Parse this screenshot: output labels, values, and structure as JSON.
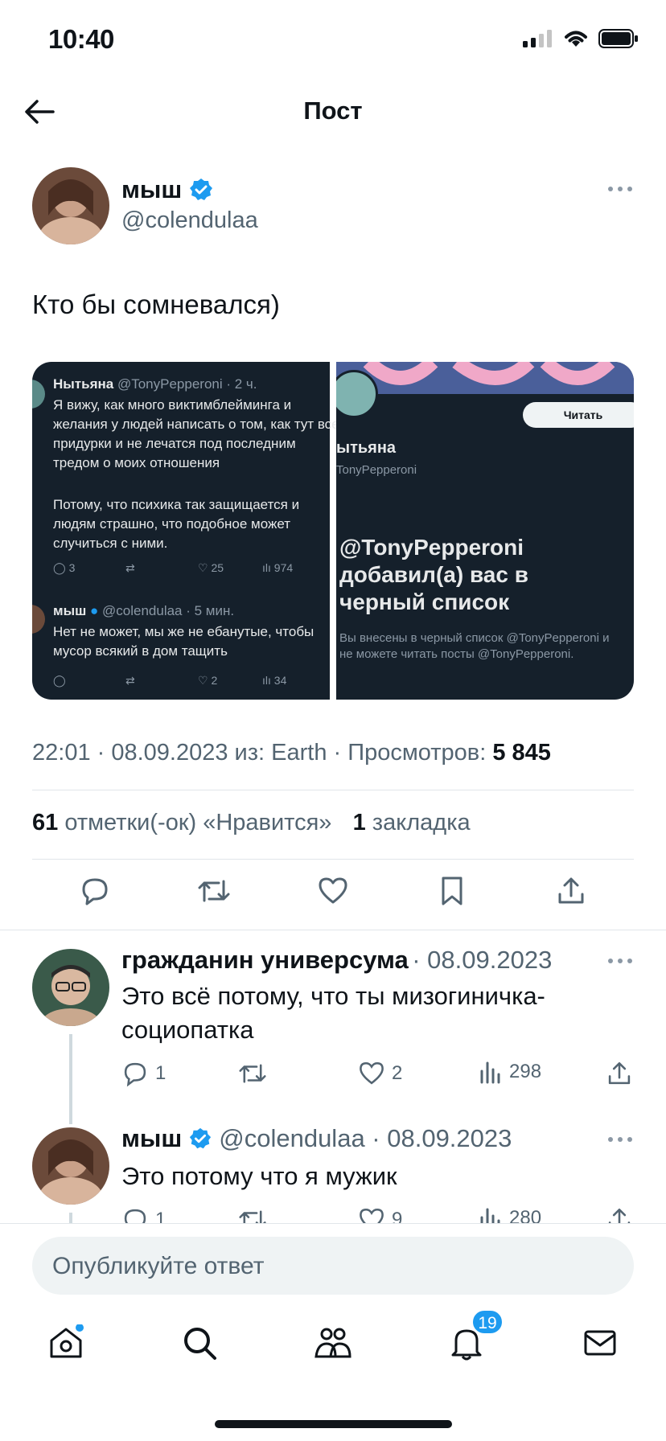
{
  "status": {
    "time": "10:40"
  },
  "header": {
    "title": "Пост"
  },
  "post": {
    "author_name": "мыш",
    "author_handle": "@colendulaa",
    "text": "Кто бы сомневался)",
    "timestamp": "22:01 · 08.09.2023 из: Earth · Просмотров: ",
    "views": "5 845",
    "likes_count": "61",
    "likes_label": "отметки(-ок) «Нравится»",
    "bookmarks_count": "1",
    "bookmarks_label": "закладка"
  },
  "media": {
    "left": {
      "tweet1_name": "Нытьяна",
      "tweet1_handle": "@TonyPepperoni · 2 ч.",
      "tweet1_text1": "Я вижу, как много виктимблейминга и желания у людей написать о том, как тут все придурки и не лечатся под последним тредом о моих отношения",
      "tweet1_text2": "Потому, что психика так защищается и людям страшно, что подобное может случиться с ними.",
      "tweet1_replies": "3",
      "tweet1_likes": "25",
      "tweet1_views": "974",
      "tweet2_name": "мыш",
      "tweet2_handle": "@colendulaa · 5 мин.",
      "tweet2_text": "Нет не может, мы же не ебанутые, чтобы мусор всякий в дом тащить",
      "tweet2_likes": "2",
      "tweet2_views": "34"
    },
    "right": {
      "follow_label": "Читать",
      "profile_name": "ытьяна",
      "profile_handle": "TonyPepperoni",
      "blocked_title": "@TonyPepperoni добавил(а) вас в черный список",
      "blocked_text": "Вы внесены в черный список @TonyPepperoni и не можете читать посты @TonyPepperoni."
    }
  },
  "replies": [
    {
      "name": "гражданин универсума",
      "meta": "· 08.09.2023",
      "text": "Это всё потому, что ты мизогиничка-социопатка",
      "replies": "1",
      "likes": "2",
      "views": "298"
    },
    {
      "name": "мыш",
      "meta": "@colendulaa · 08.09.2023",
      "text": "Это потому что я мужик",
      "replies": "1",
      "likes": "9",
      "views": "280"
    }
  ],
  "compose": {
    "placeholder": "Опубликуйте ответ"
  },
  "tabbar": {
    "notifications_badge": "19"
  },
  "colors": {
    "verified": "#1d9bf0",
    "media_bg": "#15202b",
    "muted": "#536471"
  }
}
